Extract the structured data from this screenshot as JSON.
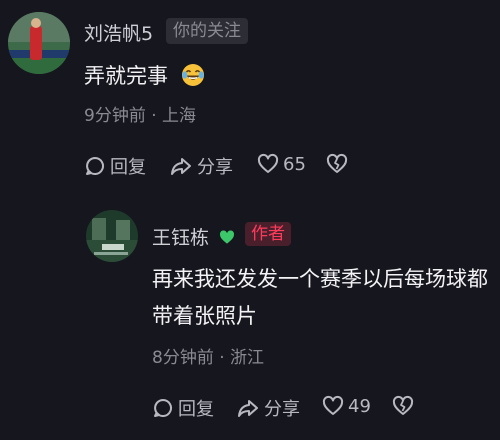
{
  "comment": {
    "author": "刘浩帆5",
    "follow_tag": "你的关注",
    "text": "弄就完事",
    "emoji": "laughing-tears-emoji",
    "time": "9分钟前",
    "location": "上海",
    "separator": "·",
    "reply_label": "回复",
    "share_label": "分享",
    "like_count": "65"
  },
  "reply": {
    "author": "王钰栋",
    "author_badge": "green-heart-icon",
    "author_tag": "作者",
    "text_line1": "再来我还发发一个赛季以后每场球都",
    "text_line2": "带着张照片",
    "time": "8分钟前",
    "location": "浙江",
    "separator": "·",
    "reply_label": "回复",
    "share_label": "分享",
    "like_count": "49"
  },
  "colors": {
    "background": "#16161e",
    "author_tag": "#ff3b5c",
    "heart_green": "#3cc76b"
  }
}
